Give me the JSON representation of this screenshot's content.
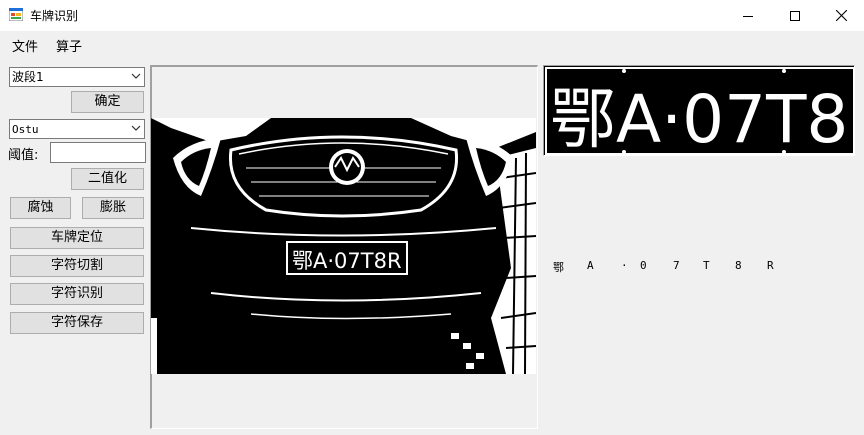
{
  "window": {
    "title": "车牌识别",
    "icon": "app-icon"
  },
  "menu": {
    "items": [
      "文件",
      "算子"
    ]
  },
  "controls": {
    "band_combo": {
      "value": "波段1"
    },
    "confirm_button": "确定",
    "method_combo": {
      "value": "Ostu"
    },
    "threshold_label": "阈值:",
    "threshold_value": "",
    "binarize_button": "二值化",
    "erode_button": "腐蚀",
    "dilate_button": "膨胀",
    "locate_button": "车牌定位",
    "segment_button": "字符切割",
    "recognize_button": "字符识别",
    "save_button": "字符保存"
  },
  "plate": {
    "text": "鄂A·07T8R",
    "chars": [
      "鄂",
      "A",
      "·",
      "0",
      "7",
      "T",
      "8",
      "R"
    ]
  },
  "colors": {
    "background": "#f0f0f0",
    "button_face": "#e1e1e1",
    "border": "#adadad"
  }
}
